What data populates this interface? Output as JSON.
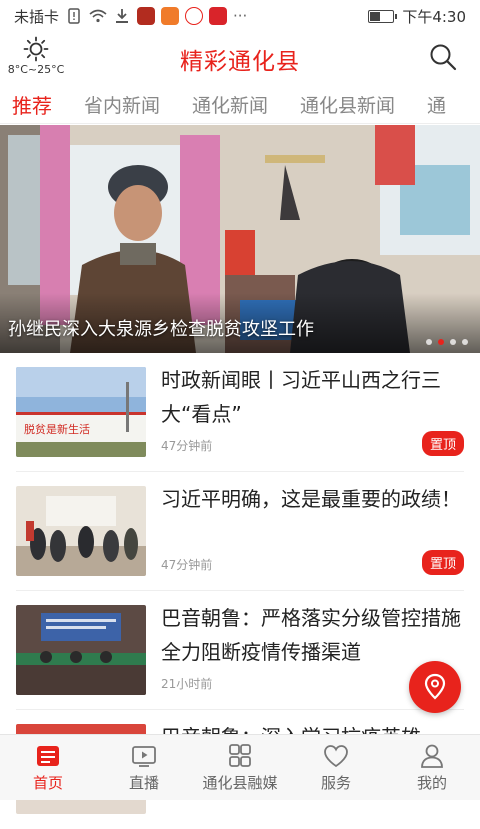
{
  "status_bar": {
    "carrier": "未插卡",
    "time": "下午4:30",
    "more": "···"
  },
  "header": {
    "weather_icon": "sun-icon",
    "weather_text": "8°C~25°C",
    "title": "精彩通化县",
    "search_icon": "search-icon"
  },
  "tabs": [
    {
      "label": "推荐",
      "active": true
    },
    {
      "label": "省内新闻",
      "active": false
    },
    {
      "label": "通化新闻",
      "active": false
    },
    {
      "label": "通化县新闻",
      "active": false
    },
    {
      "label": "通",
      "active": false
    }
  ],
  "banner": {
    "caption": "孙继民深入大泉源乡检查脱贫攻坚工作",
    "slides": 4,
    "active_slide": 2
  },
  "news": [
    {
      "title": "时政新闻眼丨习近平山西之行三大“看点”",
      "time": "47分钟前",
      "badge": "置顶",
      "thumb_text": "脱贫是新生活"
    },
    {
      "title": "习近平明确，这是最重要的政绩！",
      "time": "47分钟前",
      "badge": "置顶"
    },
    {
      "title": "巴音朝鲁：严格落实分级管控措施 全力阻断疫情传播渠道",
      "time": "21小时前",
      "badge": ""
    },
    {
      "title": "巴音朝鲁：深入学习抗疫英雄",
      "time": "",
      "badge": ""
    }
  ],
  "fab_icon": "location-pin-icon",
  "bottom_nav": [
    {
      "label": "首页",
      "icon": "home-news-icon",
      "active": true
    },
    {
      "label": "直播",
      "icon": "live-video-icon",
      "active": false
    },
    {
      "label": "通化县融媒",
      "icon": "grid-icon",
      "active": false
    },
    {
      "label": "服务",
      "icon": "heart-icon",
      "active": false
    },
    {
      "label": "我的",
      "icon": "user-icon",
      "active": false
    }
  ],
  "colors": {
    "accent": "#e8231c"
  }
}
